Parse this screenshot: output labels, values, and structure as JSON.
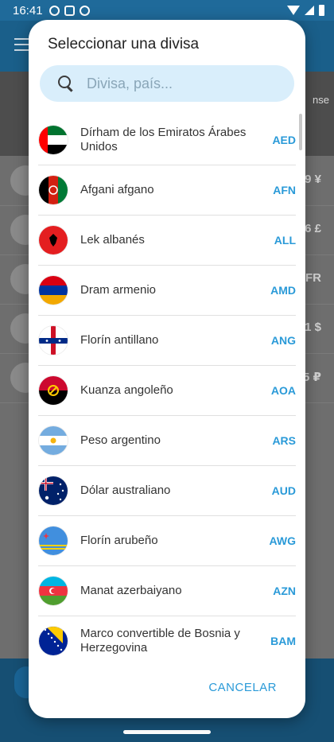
{
  "status_bar": {
    "time": "16:41"
  },
  "background": {
    "peek_text": "nse",
    "row_values": [
      "9 ¥",
      "6 £",
      "FR",
      "1 $",
      "5 ₽"
    ]
  },
  "dialog": {
    "title": "Seleccionar una divisa",
    "search": {
      "placeholder": "Divisa, país...",
      "value": ""
    },
    "cancel_label": "CANCELAR",
    "currencies": [
      {
        "name": "Dírham de los Emiratos Árabes Unidos",
        "code": "AED"
      },
      {
        "name": "Afgani afgano",
        "code": "AFN"
      },
      {
        "name": "Lek albanés",
        "code": "ALL"
      },
      {
        "name": "Dram armenio",
        "code": "AMD"
      },
      {
        "name": "Florín antillano",
        "code": "ANG"
      },
      {
        "name": "Kuanza angoleño",
        "code": "AOA"
      },
      {
        "name": "Peso argentino",
        "code": "ARS"
      },
      {
        "name": "Dólar australiano",
        "code": "AUD"
      },
      {
        "name": "Florín arubeño",
        "code": "AWG"
      },
      {
        "name": "Manat azerbaiyano",
        "code": "AZN"
      },
      {
        "name": "Marco convertible de Bosnia y Herzegovina",
        "code": "BAM"
      }
    ]
  },
  "colors": {
    "accent": "#2a9ad8",
    "search_bg": "#d9eefb"
  }
}
